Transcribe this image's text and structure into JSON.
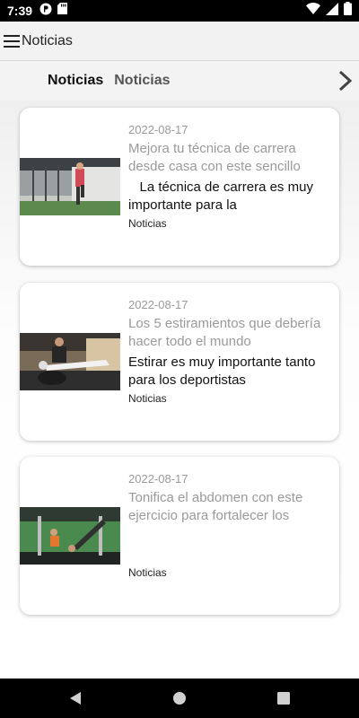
{
  "status_bar": {
    "time": "7:39",
    "icons": [
      "notification-p-icon",
      "sd-card-icon",
      "wifi-icon",
      "signal-icon",
      "battery-icon"
    ]
  },
  "app_bar": {
    "title": "Noticias",
    "menu_icon": "hamburger-menu-icon"
  },
  "tabs": {
    "items": [
      {
        "label": "Noticias",
        "active": true
      },
      {
        "label": "Noticias",
        "active": false
      }
    ],
    "next_icon": "chevron-right-icon"
  },
  "articles": [
    {
      "date": "2022-08-17",
      "title": "Mejora tu técnica de carrera desde casa con este sencillo",
      "excerpt": "   La técnica de carrera es muy importante para la",
      "category": "Noticias"
    },
    {
      "date": "2022-08-17",
      "title": "Los 5 estiramientos que debería hacer todo el mundo",
      "excerpt": "Estirar es muy importante tanto para los deportistas",
      "category": "Noticias"
    },
    {
      "date": "2022-08-17",
      "title": "Tonifica el abdomen con este ejercicio para fortalecer los",
      "excerpt": "",
      "category": "Noticias"
    }
  ],
  "nav_bar": {
    "icons": [
      "back-triangle-icon",
      "home-circle-icon",
      "recents-square-icon"
    ]
  }
}
